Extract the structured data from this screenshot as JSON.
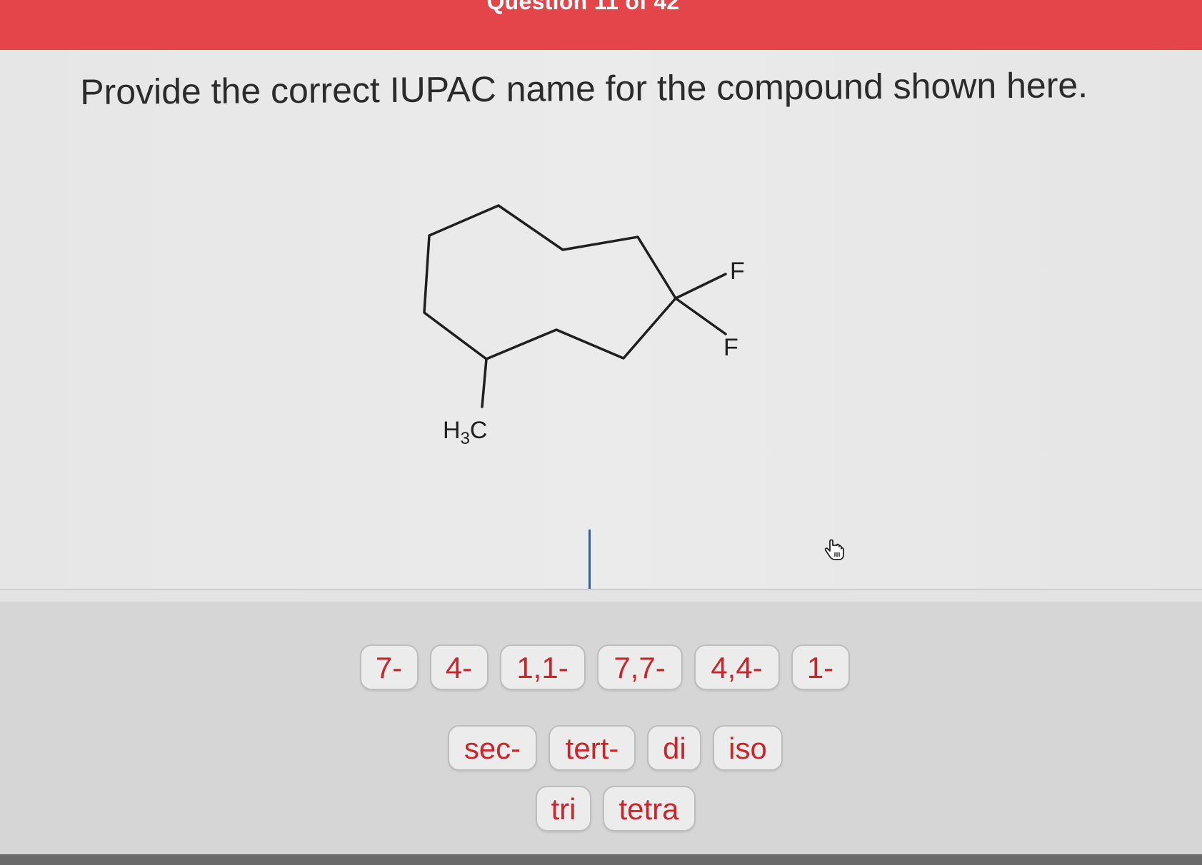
{
  "header": {
    "title": "Question 11 of 42",
    "color": "#e4454a"
  },
  "question": {
    "prompt": "Provide the correct IUPAC name for the compound shown here."
  },
  "molecule": {
    "labels": {
      "fluorine_top": "F",
      "fluorine_bottom": "F",
      "methyl_h": "H",
      "methyl_sub": "3",
      "methyl_c": "C"
    }
  },
  "answer": {
    "value": ""
  },
  "tray": {
    "row1": [
      "7-",
      "4-",
      "1,1-",
      "7,7-",
      "4,4-",
      "1-"
    ],
    "row2": [
      "sec-",
      "tert-",
      "di",
      "iso"
    ],
    "row3": [
      "tri",
      "tetra"
    ],
    "chip_text_color": "#c9262b"
  },
  "icons": {
    "pointer": "hand-pointer-icon"
  }
}
